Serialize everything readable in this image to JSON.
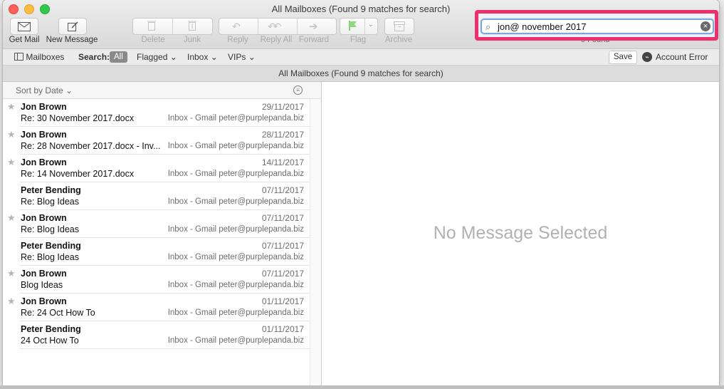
{
  "window": {
    "title": "All Mailboxes (Found 9 matches for search)"
  },
  "toolbar": {
    "get_mail": "Get Mail",
    "new_message": "New Message",
    "delete": "Delete",
    "junk": "Junk",
    "reply": "Reply",
    "reply_all": "Reply All",
    "forward": "Forward",
    "flag": "Flag",
    "archive": "Archive"
  },
  "search": {
    "value": "jon@ november 2017",
    "found": "9 Found"
  },
  "scope": {
    "mailboxes": "Mailboxes",
    "search_label": "Search:",
    "all": "All",
    "flagged": "Flagged",
    "inbox": "Inbox",
    "vips": "VIPs",
    "save": "Save",
    "account_error": "Account Error"
  },
  "header": "All Mailboxes (Found 9 matches for search)",
  "list": {
    "sort_label": "Sort by Date",
    "messages": [
      {
        "sender": "Jon Brown",
        "date": "29/11/2017",
        "subject": "Re: 30 November 2017.docx",
        "mailbox": "Inbox - Gmail peter@purplepanda.biz",
        "starred": true
      },
      {
        "sender": "Jon Brown",
        "date": "28/11/2017",
        "subject": "Re: 28 November 2017.docx - Inv...",
        "mailbox": "Inbox - Gmail peter@purplepanda.biz",
        "starred": true
      },
      {
        "sender": "Jon Brown",
        "date": "14/11/2017",
        "subject": "Re: 14 November 2017.docx",
        "mailbox": "Inbox - Gmail peter@purplepanda.biz",
        "starred": true
      },
      {
        "sender": "Peter Bending",
        "date": "07/11/2017",
        "subject": "Re: Blog Ideas",
        "mailbox": "Inbox - Gmail peter@purplepanda.biz",
        "starred": false
      },
      {
        "sender": "Jon Brown",
        "date": "07/11/2017",
        "subject": "Re: Blog Ideas",
        "mailbox": "Inbox - Gmail peter@purplepanda.biz",
        "starred": true
      },
      {
        "sender": "Peter Bending",
        "date": "07/11/2017",
        "subject": "Re: Blog Ideas",
        "mailbox": "Inbox - Gmail peter@purplepanda.biz",
        "starred": false
      },
      {
        "sender": "Jon Brown",
        "date": "07/11/2017",
        "subject": "Blog Ideas",
        "mailbox": "Inbox - Gmail peter@purplepanda.biz",
        "starred": true
      },
      {
        "sender": "Jon Brown",
        "date": "01/11/2017",
        "subject": "Re: 24 Oct How To",
        "mailbox": "Inbox - Gmail peter@purplepanda.biz",
        "starred": true
      },
      {
        "sender": "Peter Bending",
        "date": "01/11/2017",
        "subject": "24 Oct How To",
        "mailbox": "Inbox - Gmail peter@purplepanda.biz",
        "starred": false
      }
    ]
  },
  "message_pane": {
    "empty_text": "No Message Selected"
  },
  "colors": {
    "highlight": "#ef2e6e",
    "search_focus": "#7aa8e6",
    "flag_green": "#5cc24a"
  }
}
